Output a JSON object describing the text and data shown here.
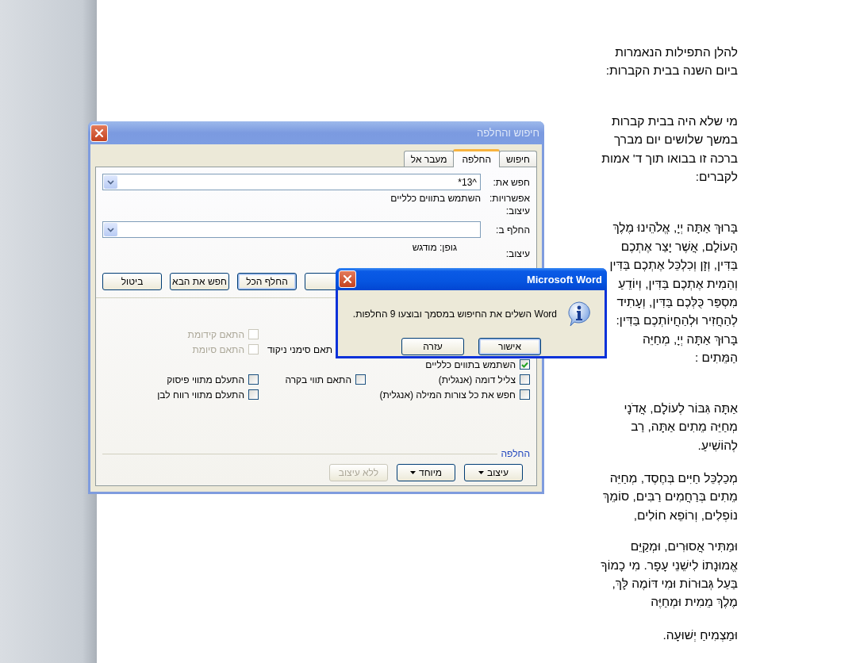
{
  "document": {
    "paragraphs": [
      {
        "lines": [
          "להלן התפילות הנאמרות",
          "ביום השנה בבית הקברות:"
        ]
      },
      {
        "lines": [
          "מי שלא היה בבית קברות",
          "במשך שלושים יום מברך",
          "ברכה זו בבואו תוך ד' אמות",
          "לקברים:"
        ]
      },
      {
        "lines": [
          "בָּרוּךְ אַתָּה יְיָ, אֱלֹהֵינוּ מֶלֶךְ",
          "הָעוֹלָם, אֲשֶׁר יָצַר אֶתְכֶם",
          "בַּדִּין, וְזָן וְכִלְכֵּל אֶתְכֶם בַּדִּין",
          "וְהֵמִית אֶתְכֶם בַּדִּין, וְיוֹדֵעַ",
          "מִסְפַּר כֻּלְּכֶם בַּדִּין, וְעָתִיד",
          "לְהַחֲזִיר וּלְהַחֲיוֹתְכֶם בַּדִּין:",
          "בָּרוּךְ אַתָּה יְיָ, מְחַיֵּה",
          "הַמֵּתִים :"
        ]
      },
      {
        "lines": [
          "אַתָּה גִּבּוֹר לְעוֹלָם, אֲדֹנָי",
          "מְחַיֵּה מֵתִים אַתָּה, רַב",
          "לְהוֹשִׁיעַ."
        ]
      },
      {
        "lines": [
          "מְכַלְכֵּל חַיִּים בְּחֶסֶד, מְחַיֵּה",
          "מֵתִים בְּרַחֲמִים רַבִּים, סוֹמֵךְ",
          "נוֹפְלִים, וְרוֹפֵא חוֹלִים,"
        ]
      },
      {
        "lines": [
          "וּמַתִּיר אֲסוּרִים, וּמְקַיֵּם",
          "אֱמוּנָתוֹ לִישֵׁנֵי עָפָר. מִי כָמוֹךָ",
          "בַּעַל גְּבוּרוֹת וּמִי דּוֹמֶה לָּךְ,",
          "מֶלֶךְ מֵמִית וּמְחַיֶּה"
        ]
      },
      {
        "lines": [
          "וּמַצְמִיחַ יְשׁוּעָה."
        ]
      }
    ]
  },
  "find_dialog": {
    "title": "חיפוש והחלפה",
    "tabs": [
      {
        "label": "חיפוש",
        "selected": false
      },
      {
        "label": "החלפה",
        "selected": true
      },
      {
        "label": "מעבר אל",
        "selected": false
      }
    ],
    "find_what": {
      "label": "חפש את:",
      "value": "^13*"
    },
    "options": {
      "label": "אפשרויות:",
      "value": "השתמש בתווים כלליים"
    },
    "find_format": {
      "label": "עיצוב:"
    },
    "replace_with": {
      "label": "החלף ב:"
    },
    "replace_format": {
      "label": "עיצוב:",
      "value": "גופן: מודגש"
    },
    "buttons": [
      {
        "label": "החלף הכל",
        "default": true
      },
      {
        "label": "חפש את הבא",
        "default": false
      },
      {
        "label": "ביטול",
        "default": false
      }
    ],
    "search_options": [
      {
        "kind": "checkbox",
        "label": "התאם קידומת",
        "checked": false,
        "disabled": true
      },
      {
        "kind": "label",
        "label": "תאם סימני ניקוד"
      },
      {
        "kind": "checkbox",
        "label": "התאם סיומת",
        "checked": false,
        "disabled": true
      },
      {
        "kind": "checkbox",
        "label": "השתמש בתווים כלליים",
        "checked": true,
        "disabled": false
      },
      {
        "kind": "checkbox",
        "label": "צליל דומה (אנגלית)",
        "checked": false,
        "disabled": false
      },
      {
        "kind": "checkbox",
        "label": "התאם תווי בקרה",
        "checked": false,
        "disabled": false
      },
      {
        "kind": "checkbox",
        "label": "התעלם מתווי פיסוק",
        "checked": false,
        "disabled": false
      },
      {
        "kind": "checkbox",
        "label": "חפש את כל צורות המילה (אנגלית)",
        "checked": false,
        "disabled": false
      },
      {
        "kind": "checkbox",
        "label": "התעלם מתווי רווח לבן",
        "checked": false,
        "disabled": false
      }
    ],
    "section_label": "החלפה",
    "bottom_buttons": [
      {
        "label": "עיצוב",
        "menu": true,
        "disabled": false
      },
      {
        "label": "מיוחד",
        "menu": true,
        "disabled": false
      },
      {
        "label": "ללא עיצוב",
        "menu": false,
        "disabled": true
      }
    ]
  },
  "message_box": {
    "title": "Microsoft Word",
    "message": "Word השלים את החיפוש במסמך ובוצעו 9 החלפות.",
    "buttons": [
      {
        "label": "אישור",
        "default": true
      },
      {
        "label": "עזרה",
        "default": false
      }
    ]
  }
}
